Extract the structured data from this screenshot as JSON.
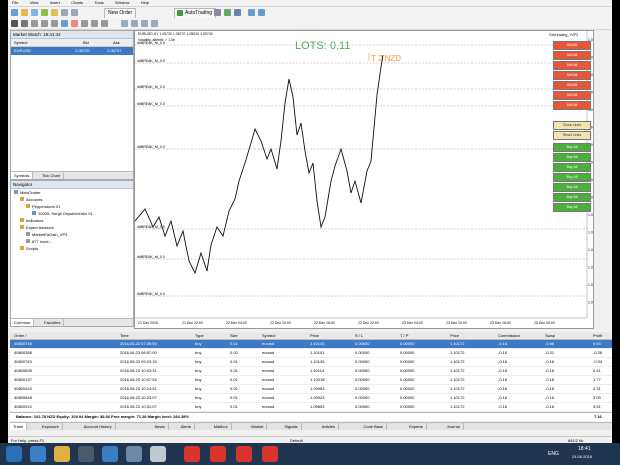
{
  "menu": [
    "File",
    "View",
    "Insert",
    "Charts",
    "Tools",
    "Window",
    "Help"
  ],
  "toolbar": {
    "new_order": "New Order",
    "autotrading": "AutoTrading"
  },
  "market_watch": {
    "title": "Market Watch: 18:41:42",
    "columns": [
      "Symbol",
      "Bid",
      "Ask"
    ],
    "rows": [
      {
        "symbol": "EURUSD",
        "bid": "1.05720",
        "ask": "1.05737"
      }
    ],
    "tabs": [
      "Symbols",
      "Tick Chart"
    ]
  },
  "navigator": {
    "title": "Navigator",
    "tree": [
      "MetaTrader",
      "Accounts",
      "Pepperstone-01",
      "10005: Sergii Onyshchenko 01",
      "Indicators",
      "Expert Advisors",
      "MarketEaGain_VP3",
      "877 more...",
      "Scripts"
    ],
    "tabs": [
      "Common",
      "Favorites"
    ]
  },
  "chart": {
    "title": "EURUSD,H1  1.05720 1.05737 1.05020 1.05720",
    "subtitle": "Volatility, altered: > 1.0e",
    "lots_label": "LOTS: 0.11",
    "tp_label": "T 2 NZD",
    "indicator_name": "Grid trading_+VP3",
    "left_labels": [
      "##BREAK_lvl_0.0",
      "##BREAK_lvl_0.0",
      "##BREAK_lvl_0.0",
      "##BREAK_lvl_0.0",
      "##BREAK_lvl_0.0",
      "##BREAK_lvl_0.0",
      "##BREAK_lvl_0.0",
      "##BREAK_lvl_0.0"
    ],
    "price_axis": [
      "1.06100",
      "1.06000",
      "1.05850",
      "1.05700",
      "1.05520",
      "1.05400",
      "1.05250",
      "1.05100",
      "1.04950",
      "1.04800",
      "1.04650",
      "1.04500",
      "1.04350",
      "1.04200",
      "1.04050",
      "1.03900"
    ],
    "time_axis": [
      "21 Dec 2016",
      "21 Dec 22:00",
      "22 Dec 04:00",
      "22 Dec 10:00",
      "22 Dec 16:00",
      "22 Dec 22:00",
      "23 Dec 04:00",
      "23 Dec 10:00",
      "23 Dec 16:00",
      "26 Dec 00:00"
    ],
    "sell_buttons": [
      "Sell All",
      "Sell All",
      "Sell All",
      "Sell All",
      "Sell All",
      "Sell All",
      "Sell All"
    ],
    "close_buttons": [
      "Close Lines",
      "Reset Lines"
    ],
    "buy_buttons": [
      "Buy All",
      "Buy All",
      "Buy All",
      "Buy All",
      "Buy All",
      "Buy All",
      "Buy All"
    ]
  },
  "orders": {
    "columns": [
      "Order /",
      "Time",
      "Type",
      "Size",
      "Symbol",
      "Price",
      "S / L",
      "T / P",
      "Price",
      "Commission",
      "Swap",
      "Profit"
    ],
    "rows": [
      [
        "40800745",
        "2016.06.22 07:59:59",
        "buy",
        "0.01",
        "eurusd",
        "1.10143",
        "0.00000",
        "0.00000",
        "1.10172",
        "-0.16",
        "-0.66",
        "0.63"
      ],
      [
        "40800388",
        "2016.06.23 08:57:00",
        "buy",
        "0.02",
        "eurusd",
        "1.10101",
        "0.00000",
        "0.00000",
        "1.10172",
        "-0.16",
        "-0.21",
        "-0.26"
      ],
      [
        "40800763",
        "2016.06.23 09:23:15",
        "buy",
        "0.01",
        "eurusd",
        "1.10135",
        "0.00000",
        "0.00000",
        "1.10172",
        "-0.16",
        "-0.16",
        "-0.33"
      ],
      [
        "40800695",
        "2016.06.23 10:03:31",
        "buy",
        "0.01",
        "eurusd",
        "1.10114",
        "0.00000",
        "0.00000",
        "1.10172",
        "-0.16",
        "-0.16",
        "0.41"
      ],
      [
        "40800137",
        "2016.06.23 10:07:54",
        "buy",
        "0.01",
        "eurusd",
        "1.10018",
        "0.00000",
        "0.00000",
        "1.10172",
        "-0.16",
        "-0.16",
        "1.77"
      ],
      [
        "40800443",
        "2016.06.23 10:14:51",
        "buy",
        "0.01",
        "eurusd",
        "1.09983",
        "0.00000",
        "0.00000",
        "1.10172",
        "-0.16",
        "-0.16",
        "2.31"
      ],
      [
        "40800848",
        "2016.06.23 10:23:07",
        "buy",
        "0.01",
        "eurusd",
        "1.09923",
        "0.00000",
        "0.00000",
        "1.10172",
        "-0.16",
        "-0.16",
        "3.03"
      ],
      [
        "40800910",
        "2016.06.23 10:31:07",
        "buy",
        "0.01",
        "eurusd",
        "1.09853",
        "0.00000",
        "0.00000",
        "1.10172",
        "-0.16",
        "-0.16",
        "3.61"
      ]
    ],
    "balance_line": "Balance: 102.78 NZD  Equity: 109.94  Margin: 38.66  Free margin: 71.28  Margin level: 284.39%",
    "balance_total": "7.16"
  },
  "terminal_tabs": [
    "Trade",
    "Exposure",
    "Account History",
    "News",
    "Alerts",
    "Mailbox",
    "Market",
    "Signals",
    "Articles",
    "Code Base",
    "Experts",
    "Journal"
  ],
  "status": {
    "left": "For Help, press F1",
    "mid": "Default",
    "right": "681/2 kb"
  },
  "taskbar": {
    "lang": "ENG",
    "time": "18:41",
    "date": "24.06.2016"
  },
  "colors": {
    "sell": "#e8563a",
    "buy": "#4caf3b",
    "close": "#f3e3b0",
    "lots": "#4caf50",
    "tp": "#ff9933"
  }
}
